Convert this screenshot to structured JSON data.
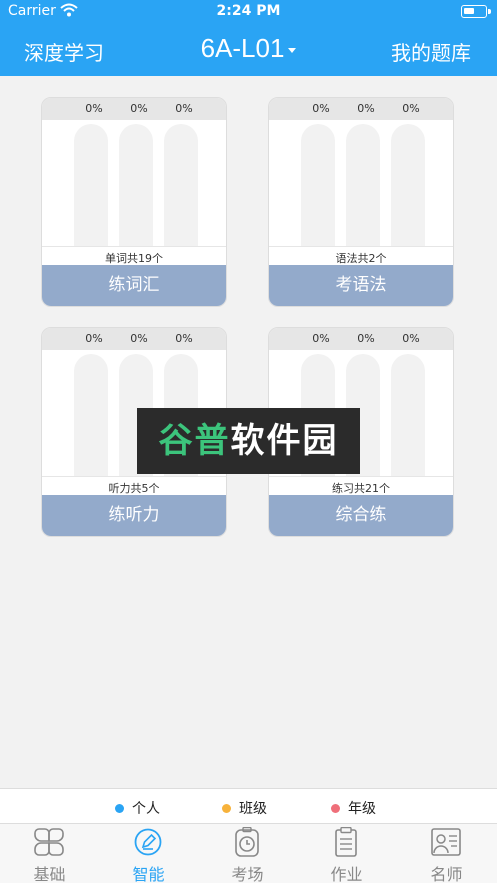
{
  "status_bar": {
    "carrier": "Carrier",
    "time": "2:24 PM"
  },
  "nav": {
    "left": "深度学习",
    "title": "6A-L01",
    "right": "我的题库"
  },
  "cards": [
    {
      "percents": [
        "0%",
        "0%",
        "0%"
      ],
      "count": "单词共19个",
      "action": "练词汇"
    },
    {
      "percents": [
        "0%",
        "0%",
        "0%"
      ],
      "count": "语法共2个",
      "action": "考语法"
    },
    {
      "percents": [
        "0%",
        "0%",
        "0%"
      ],
      "count": "听力共5个",
      "action": "练听力"
    },
    {
      "percents": [
        "0%",
        "0%",
        "0%"
      ],
      "count": "练习共21个",
      "action": "综合练"
    }
  ],
  "watermark": {
    "part1": "谷普",
    "part2": "软件园"
  },
  "legend": [
    {
      "label": "个人",
      "color": "#2aa4f4"
    },
    {
      "label": "班级",
      "color": "#f7b23b"
    },
    {
      "label": "年级",
      "color": "#ef6f7a"
    }
  ],
  "tabs": [
    {
      "label": "基础",
      "icon": "grid-icon"
    },
    {
      "label": "智能",
      "icon": "pencil-circle-icon"
    },
    {
      "label": "考场",
      "icon": "timer-icon"
    },
    {
      "label": "作业",
      "icon": "clipboard-icon"
    },
    {
      "label": "名师",
      "icon": "contact-card-icon"
    }
  ],
  "active_tab": "智能",
  "colors": {
    "accent": "#2aa4f4",
    "card_action": "#93aacb"
  }
}
